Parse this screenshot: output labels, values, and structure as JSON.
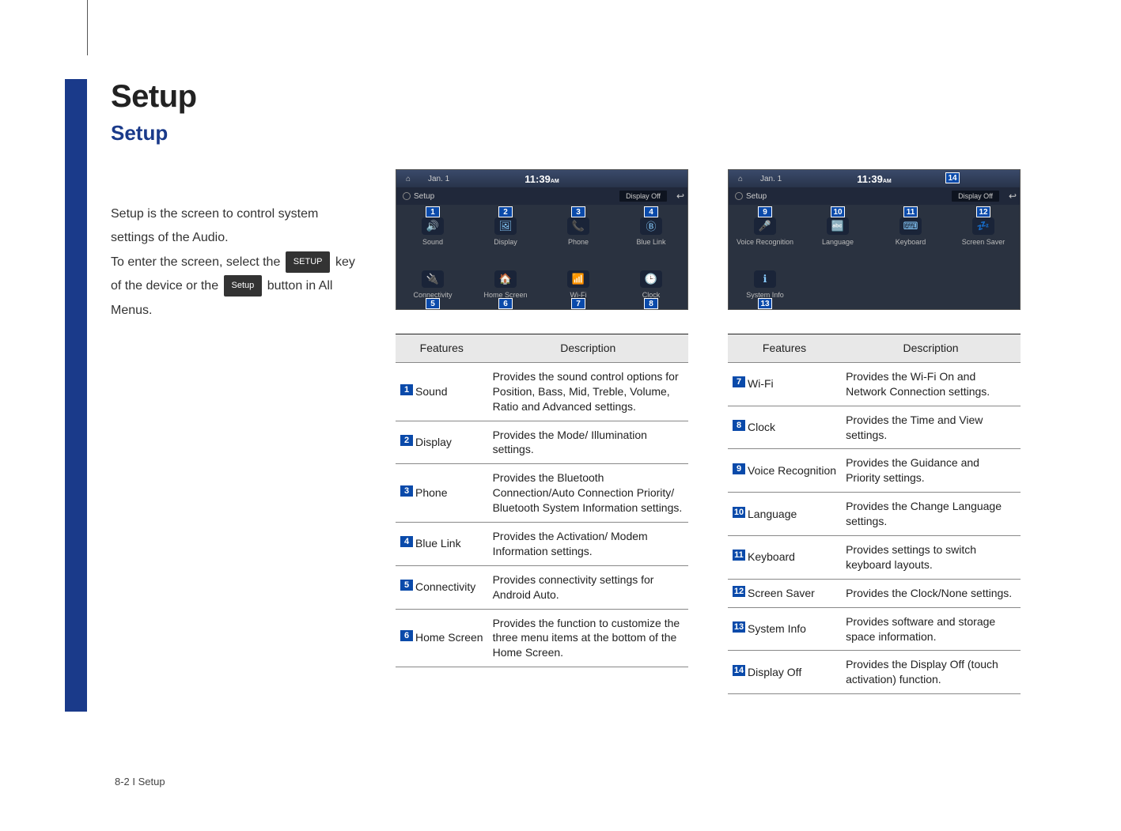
{
  "page": {
    "title": "Setup",
    "subtitle": "Setup",
    "intro1": "Setup is the screen to control system settings of the Audio.",
    "intro2a": "To enter the screen, select the ",
    "btn_setup_upper": "SETUP",
    "intro2b": " key of the device or the ",
    "btn_setup_lower": "Setup",
    "intro2c": " button in All Menus.",
    "footer": "8-2 I Setup"
  },
  "ui_common": {
    "date": "Jan.  1",
    "time": "11:39",
    "time_ampm": "AM",
    "setup_label": "Setup",
    "display_off": "Display Off",
    "back_glyph": "↩"
  },
  "ui1": {
    "cells": [
      {
        "num": "1",
        "num_pos": "top",
        "icon": "🔊",
        "label": "Sound",
        "name": "sound-icon"
      },
      {
        "num": "2",
        "num_pos": "top",
        "icon": "🖼",
        "label": "Display",
        "name": "display-icon"
      },
      {
        "num": "3",
        "num_pos": "top",
        "icon": "📞",
        "label": "Phone",
        "name": "phone-icon"
      },
      {
        "num": "4",
        "num_pos": "top",
        "icon": "Ⓑ",
        "label": "Blue Link",
        "name": "blue-link-icon"
      },
      {
        "num": "5",
        "num_pos": "bot",
        "icon": "🔌",
        "label": "Connectivity",
        "name": "connectivity-icon"
      },
      {
        "num": "6",
        "num_pos": "bot",
        "icon": "🏠",
        "label": "Home Screen",
        "name": "home-screen-icon"
      },
      {
        "num": "7",
        "num_pos": "bot",
        "icon": "📶",
        "label": "Wi-Fi",
        "name": "wifi-icon"
      },
      {
        "num": "8",
        "num_pos": "bot",
        "icon": "🕒",
        "label": "Clock",
        "name": "clock-icon"
      }
    ]
  },
  "ui2": {
    "callout14": "14",
    "cells": [
      {
        "num": "9",
        "num_pos": "top",
        "icon": "🎤",
        "label": "Voice Recognition",
        "name": "voice-recognition-icon"
      },
      {
        "num": "10",
        "num_pos": "top",
        "icon": "🔤",
        "label": "Language",
        "name": "language-icon"
      },
      {
        "num": "11",
        "num_pos": "top",
        "icon": "⌨",
        "label": "Keyboard",
        "name": "keyboard-icon"
      },
      {
        "num": "12",
        "num_pos": "top",
        "icon": "💤",
        "label": "Screen Saver",
        "name": "screen-saver-icon"
      },
      {
        "num": "13",
        "num_pos": "bot",
        "icon": "ℹ",
        "label": "System Info",
        "name": "system-info-icon"
      }
    ]
  },
  "table_headers": {
    "features": "Features",
    "description": "Description"
  },
  "table1": [
    {
      "n": "1",
      "name": "Sound",
      "desc": "Provides the sound control options for Position, Bass, Mid, Treble, Volume, Ratio and Advanced settings."
    },
    {
      "n": "2",
      "name": "Display",
      "desc": "Provides the Mode/\nIllumination settings."
    },
    {
      "n": "3",
      "name": "Phone",
      "desc": "Provides the Bluetooth Connection/Auto Connection Priority/\nBluetooth System Information settings."
    },
    {
      "n": "4",
      "name": "Blue Link",
      "desc": "Provides the Activation/\nModem Information settings."
    },
    {
      "n": "5",
      "name": "Connectivity",
      "desc": "Provides connectivity settings for Android Auto."
    },
    {
      "n": "6",
      "name": "Home Screen",
      "desc": "Provides the function to customize the three menu items at the bottom of the Home Screen."
    }
  ],
  "table2": [
    {
      "n": "7",
      "name": "Wi-Fi",
      "desc": "Provides the Wi-Fi On and Network Connection settings."
    },
    {
      "n": "8",
      "name": "Clock",
      "desc": "Provides the Time and View settings."
    },
    {
      "n": "9",
      "name": "Voice Recognition",
      "desc": "Provides the Guidance and Priority settings."
    },
    {
      "n": "10",
      "name": "Language",
      "desc": "Provides the Change Language settings."
    },
    {
      "n": "11",
      "name": "Keyboard",
      "desc": "Provides settings to switch keyboard layouts."
    },
    {
      "n": "12",
      "name": "Screen Saver",
      "desc": "Provides the Clock/None settings."
    },
    {
      "n": "13",
      "name": "System Info",
      "desc": "Provides software and storage space information."
    },
    {
      "n": "14",
      "name": "Display Off",
      "desc": "Provides the Display Off (touch activation) function."
    }
  ]
}
